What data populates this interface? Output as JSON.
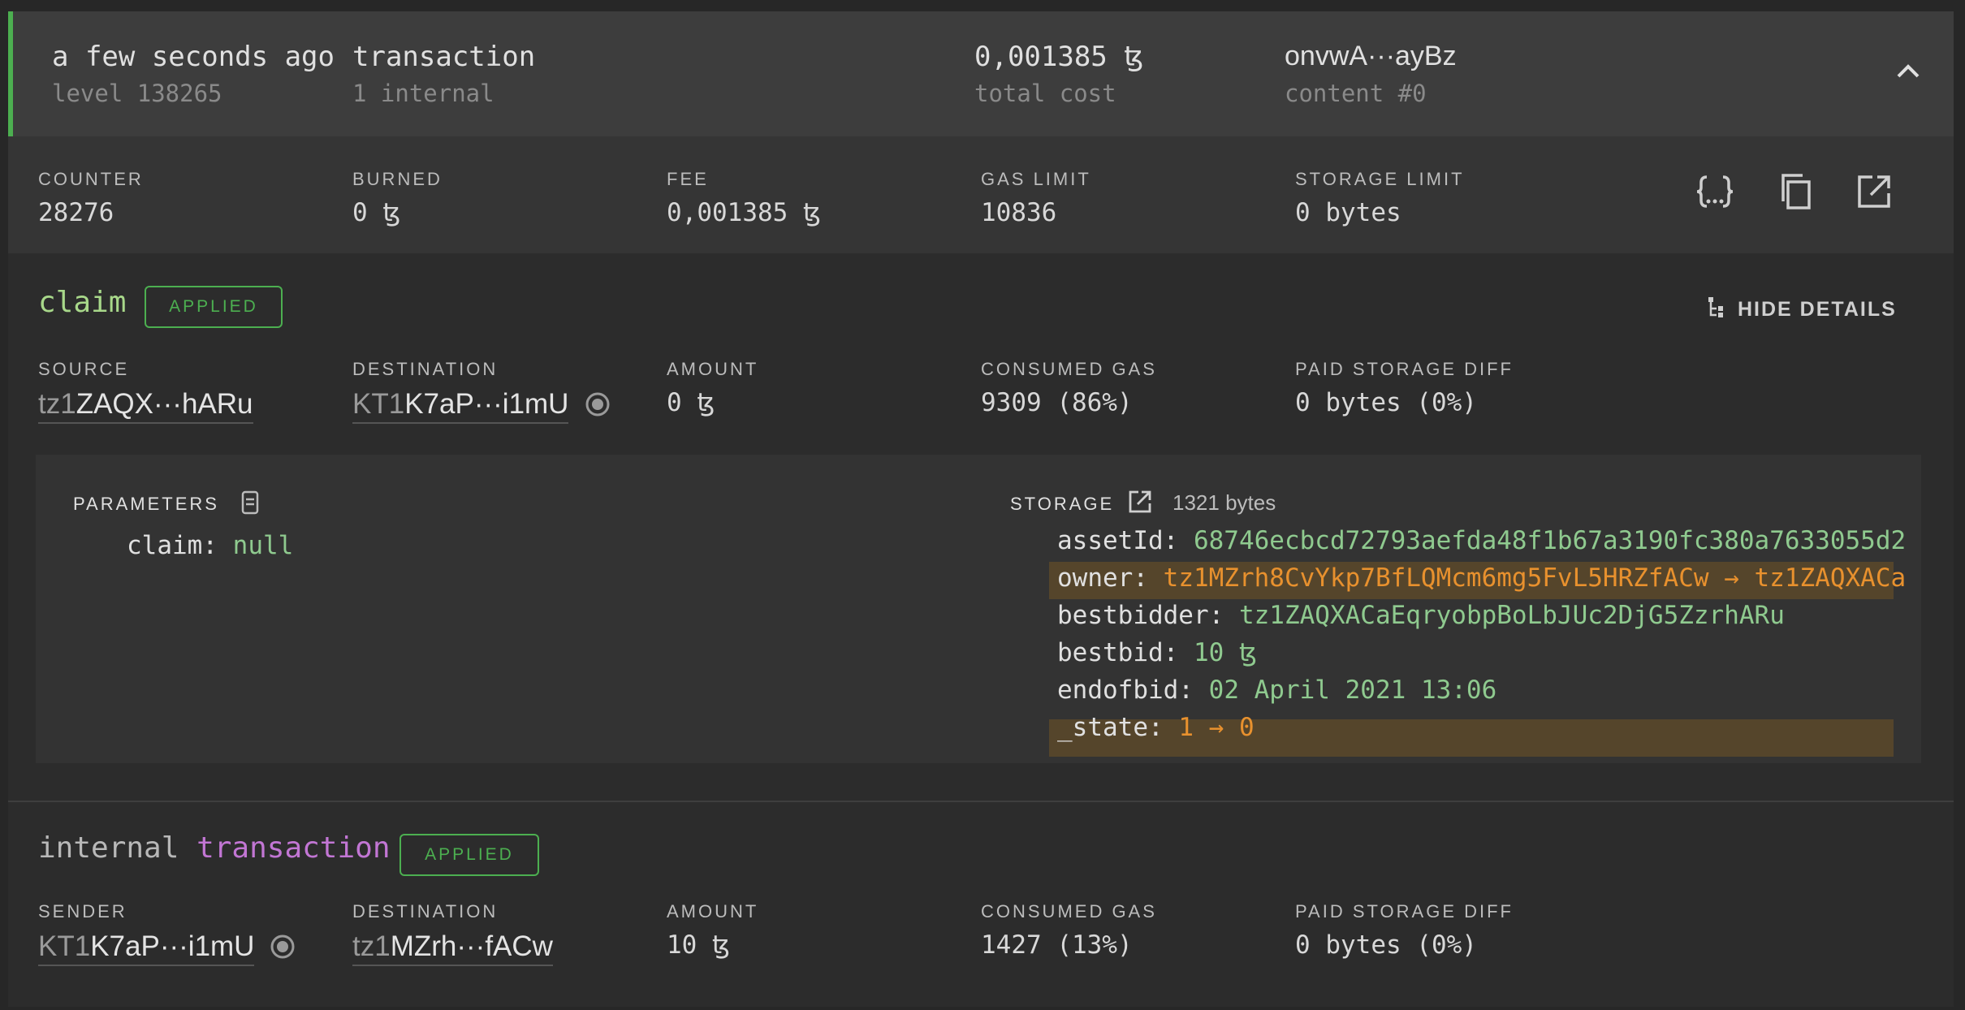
{
  "header": {
    "time": "a few seconds ago",
    "kind": "transaction",
    "level": "level 138265",
    "internal": "1 internal",
    "cost": "0,001385",
    "cost_unit": "ꜩ",
    "cost_label": "total cost",
    "hash": "onvwA···ayBz",
    "content": "content #0"
  },
  "stats": [
    {
      "label": "COUNTER",
      "value": "28276"
    },
    {
      "label": "BURNED",
      "value": "0 ꜩ"
    },
    {
      "label": "FEE",
      "value": "0,001385 ꜩ"
    },
    {
      "label": "GAS LIMIT",
      "value": "10836"
    },
    {
      "label": "STORAGE LIMIT",
      "value": "0 bytes"
    }
  ],
  "op": {
    "entrypoint": "claim",
    "status": "APPLIED",
    "hide_details": "HIDE DETAILS",
    "fields": [
      {
        "label": "SOURCE",
        "prefix": "tz1",
        "addr": "ZAQX···hARu"
      },
      {
        "label": "DESTINATION",
        "prefix": "KT1",
        "addr": "K7aP···i1mU"
      },
      {
        "label": "AMOUNT",
        "value": "0 ꜩ"
      },
      {
        "label": "CONSUMED GAS",
        "value": "9309 (86%)"
      },
      {
        "label": "PAID STORAGE DIFF",
        "value": "0 bytes (0%)"
      }
    ]
  },
  "params": {
    "label": "PARAMETERS",
    "key": "claim:",
    "value": "null"
  },
  "storage": {
    "label": "STORAGE",
    "size": "1321 bytes",
    "rows": [
      {
        "key": "assetId:",
        "value": "68746ecbcd72793aefda48f1b67a3190fc380a7633055d2"
      },
      {
        "key": "owner:",
        "value": "tz1MZrh8CvYkp7BfLQMcm6mg5FvL5HRZfACw → tz1ZAQXACa"
      },
      {
        "key": "bestbidder:",
        "value": "tz1ZAQXACaEqryobpBoLbJUc2DjG5ZzrhARu"
      },
      {
        "key": "bestbid:",
        "value": "10 ꜩ"
      },
      {
        "key": "endofbid:",
        "value": "02 April 2021 13:06"
      },
      {
        "key": "_state:",
        "value": "1 → 0"
      }
    ]
  },
  "internal": {
    "prefix": "internal",
    "kind": "transaction",
    "status": "APPLIED",
    "fields": [
      {
        "label": "SENDER",
        "prefix": "KT1",
        "addr": "K7aP···i1mU"
      },
      {
        "label": "DESTINATION",
        "prefix": "tz1",
        "addr": "MZrh···fACw"
      },
      {
        "label": "AMOUNT",
        "value": "10 ꜩ"
      },
      {
        "label": "CONSUMED GAS",
        "value": "1427 (13%)"
      },
      {
        "label": "PAID STORAGE DIFF",
        "value": "0 bytes (0%)"
      }
    ]
  },
  "colors": {
    "accent_green": "#4caf50",
    "value_green": "#8fca8f",
    "changed_orange": "#e8912e",
    "kind_purple": "#c276d4"
  },
  "icons": [
    "chevron-up-icon",
    "json-braces-icon",
    "copy-icon",
    "open-external-icon",
    "tree-icon",
    "contract-dot-icon",
    "file-icon"
  ]
}
